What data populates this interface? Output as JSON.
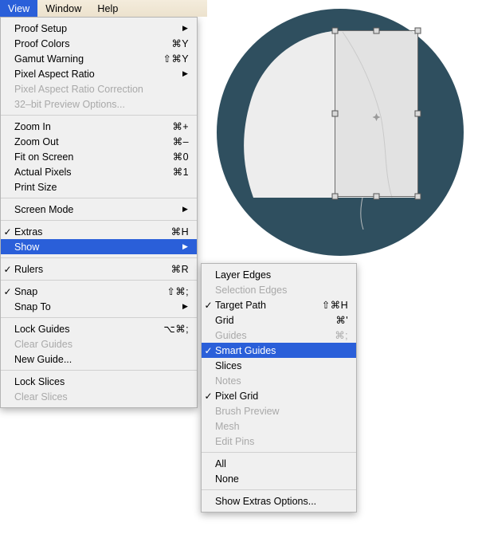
{
  "menubar": {
    "items": [
      {
        "label": "View",
        "active": true
      },
      {
        "label": "Window",
        "active": false
      },
      {
        "label": "Help",
        "active": false
      }
    ]
  },
  "view_menu": {
    "groups": [
      {
        "items": [
          {
            "label": "Proof Setup",
            "shortcut": "",
            "check": "",
            "arrow": "▶",
            "disabled": false,
            "selected": false
          },
          {
            "label": "Proof Colors",
            "shortcut": "⌘Y",
            "check": "",
            "arrow": "",
            "disabled": false,
            "selected": false
          },
          {
            "label": "Gamut Warning",
            "shortcut": "⇧⌘Y",
            "check": "",
            "arrow": "",
            "disabled": false,
            "selected": false
          },
          {
            "label": "Pixel Aspect Ratio",
            "shortcut": "",
            "check": "",
            "arrow": "▶",
            "disabled": false,
            "selected": false
          },
          {
            "label": "Pixel Aspect Ratio Correction",
            "shortcut": "",
            "check": "",
            "arrow": "",
            "disabled": true,
            "selected": false
          },
          {
            "label": "32–bit Preview Options...",
            "shortcut": "",
            "check": "",
            "arrow": "",
            "disabled": true,
            "selected": false
          }
        ]
      },
      {
        "items": [
          {
            "label": "Zoom In",
            "shortcut": "⌘+",
            "check": "",
            "arrow": "",
            "disabled": false,
            "selected": false
          },
          {
            "label": "Zoom Out",
            "shortcut": "⌘–",
            "check": "",
            "arrow": "",
            "disabled": false,
            "selected": false
          },
          {
            "label": "Fit on Screen",
            "shortcut": "⌘0",
            "check": "",
            "arrow": "",
            "disabled": false,
            "selected": false
          },
          {
            "label": "Actual Pixels",
            "shortcut": "⌘1",
            "check": "",
            "arrow": "",
            "disabled": false,
            "selected": false
          },
          {
            "label": "Print Size",
            "shortcut": "",
            "check": "",
            "arrow": "",
            "disabled": false,
            "selected": false
          }
        ]
      },
      {
        "items": [
          {
            "label": "Screen Mode",
            "shortcut": "",
            "check": "",
            "arrow": "▶",
            "disabled": false,
            "selected": false
          }
        ]
      },
      {
        "items": [
          {
            "label": "Extras",
            "shortcut": "⌘H",
            "check": "✓",
            "arrow": "",
            "disabled": false,
            "selected": false
          },
          {
            "label": "Show",
            "shortcut": "",
            "check": "",
            "arrow": "▶",
            "disabled": false,
            "selected": true
          }
        ]
      },
      {
        "items": [
          {
            "label": "Rulers",
            "shortcut": "⌘R",
            "check": "✓",
            "arrow": "",
            "disabled": false,
            "selected": false
          }
        ]
      },
      {
        "items": [
          {
            "label": "Snap",
            "shortcut": "⇧⌘;",
            "check": "✓",
            "arrow": "",
            "disabled": false,
            "selected": false
          },
          {
            "label": "Snap To",
            "shortcut": "",
            "check": "",
            "arrow": "▶",
            "disabled": false,
            "selected": false
          }
        ]
      },
      {
        "items": [
          {
            "label": "Lock Guides",
            "shortcut": "⌥⌘;",
            "check": "",
            "arrow": "",
            "disabled": false,
            "selected": false
          },
          {
            "label": "Clear Guides",
            "shortcut": "",
            "check": "",
            "arrow": "",
            "disabled": true,
            "selected": false
          },
          {
            "label": "New Guide...",
            "shortcut": "",
            "check": "",
            "arrow": "",
            "disabled": false,
            "selected": false
          }
        ]
      },
      {
        "items": [
          {
            "label": "Lock Slices",
            "shortcut": "",
            "check": "",
            "arrow": "",
            "disabled": false,
            "selected": false
          },
          {
            "label": "Clear Slices",
            "shortcut": "",
            "check": "",
            "arrow": "",
            "disabled": true,
            "selected": false
          }
        ]
      }
    ]
  },
  "show_submenu": {
    "groups": [
      {
        "items": [
          {
            "label": "Layer Edges",
            "shortcut": "",
            "check": "",
            "arrow": "",
            "disabled": false,
            "selected": false
          },
          {
            "label": "Selection Edges",
            "shortcut": "",
            "check": "",
            "arrow": "",
            "disabled": true,
            "selected": false
          },
          {
            "label": "Target Path",
            "shortcut": "⇧⌘H",
            "check": "✓",
            "arrow": "",
            "disabled": false,
            "selected": false
          },
          {
            "label": "Grid",
            "shortcut": "⌘'",
            "check": "",
            "arrow": "",
            "disabled": false,
            "selected": false
          },
          {
            "label": "Guides",
            "shortcut": "⌘;",
            "check": "",
            "arrow": "",
            "disabled": true,
            "selected": false
          },
          {
            "label": "Smart Guides",
            "shortcut": "",
            "check": "✓",
            "arrow": "",
            "disabled": false,
            "selected": true
          },
          {
            "label": "Slices",
            "shortcut": "",
            "check": "",
            "arrow": "",
            "disabled": false,
            "selected": false
          },
          {
            "label": "Notes",
            "shortcut": "",
            "check": "",
            "arrow": "",
            "disabled": true,
            "selected": false
          },
          {
            "label": "Pixel Grid",
            "shortcut": "",
            "check": "✓",
            "arrow": "",
            "disabled": false,
            "selected": false
          },
          {
            "label": "Brush Preview",
            "shortcut": "",
            "check": "",
            "arrow": "",
            "disabled": true,
            "selected": false
          },
          {
            "label": "Mesh",
            "shortcut": "",
            "check": "",
            "arrow": "",
            "disabled": true,
            "selected": false
          },
          {
            "label": "Edit Pins",
            "shortcut": "",
            "check": "",
            "arrow": "",
            "disabled": true,
            "selected": false
          }
        ]
      },
      {
        "items": [
          {
            "label": "All",
            "shortcut": "",
            "check": "",
            "arrow": "",
            "disabled": false,
            "selected": false
          },
          {
            "label": "None",
            "shortcut": "",
            "check": "",
            "arrow": "",
            "disabled": false,
            "selected": false
          }
        ]
      },
      {
        "items": [
          {
            "label": "Show Extras Options...",
            "shortcut": "",
            "check": "",
            "arrow": "",
            "disabled": false,
            "selected": false
          }
        ]
      }
    ]
  },
  "canvas": {
    "circle_color": "#2f4f5f",
    "shape_color": "#ededed",
    "selection_fill": "#dcdcdc",
    "selection_stroke": "#6b6b6b",
    "handle_fill": "#d9d9d9",
    "handle_stroke": "#555555"
  }
}
